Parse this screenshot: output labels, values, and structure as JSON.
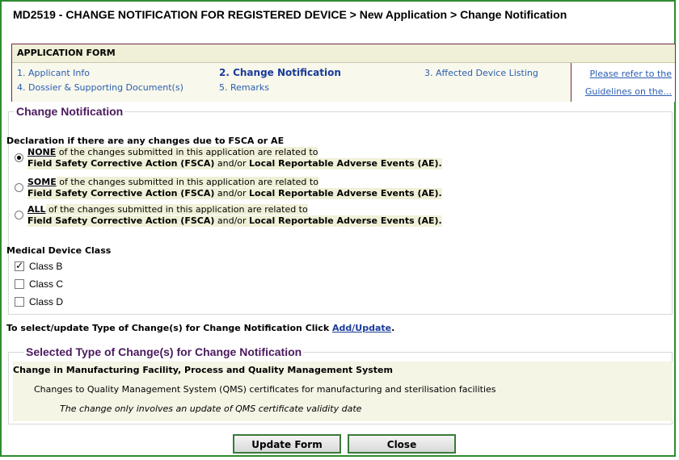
{
  "page": {
    "title": "MD2519 - CHANGE NOTIFICATION FOR REGISTERED DEVICE > New Application > Change Notification"
  },
  "application_form": {
    "header": "APPLICATION FORM",
    "steps": [
      {
        "label": "1. Applicant Info",
        "active": false
      },
      {
        "label": "2. Change Notification",
        "active": true
      },
      {
        "label": "3. Affected Device Listing",
        "active": false
      },
      {
        "label": "4. Dossier & Supporting Document(s)",
        "active": false
      },
      {
        "label": "5. Remarks",
        "active": false
      }
    ],
    "guide_link_line1": "Please refer to the",
    "guide_link_line2": "Guidelines on the..."
  },
  "change_notification": {
    "legend": "Change Notification",
    "declaration_heading": "Declaration if there are any changes due to FSCA or AE",
    "options": [
      {
        "keyword": "NONE",
        "rest_line1": " of the changes submitted in this application are related to",
        "line2_bold1": "Field Safety Corrective Action (FSCA)",
        "line2_mid": " and/or ",
        "line2_bold2": "Local Reportable Adverse Events (AE).",
        "checked": true
      },
      {
        "keyword": "SOME",
        "rest_line1": " of the changes submitted in this application are related to",
        "line2_bold1": "Field Safety Corrective Action (FSCA)",
        "line2_mid": " and/or ",
        "line2_bold2": "Local Reportable Adverse Events (AE).",
        "checked": false
      },
      {
        "keyword": "ALL",
        "rest_line1": " of the changes submitted in this application are related to",
        "line2_bold1": "Field Safety Corrective Action (FSCA)",
        "line2_mid": " and/or ",
        "line2_bold2": "Local Reportable Adverse Events (AE).",
        "checked": false
      }
    ],
    "device_class_heading": "Medical Device Class",
    "device_classes": [
      {
        "label": "Class B",
        "checked": true
      },
      {
        "label": "Class C",
        "checked": false
      },
      {
        "label": "Class D",
        "checked": false
      }
    ]
  },
  "select_update": {
    "text": "To select/update Type of Change(s) for Change Notification Click ",
    "link": "Add/Update",
    "suffix": "."
  },
  "selected_changes": {
    "legend": "Selected Type of Change(s) for Change Notification",
    "category": "Change in Manufacturing Facility, Process and Quality Management System",
    "item": "Changes to Quality Management System (QMS) certificates for manufacturing and sterilisation facilities",
    "detail": "The change only involves an update of QMS certificate validity date"
  },
  "buttons": {
    "update": "Update Form",
    "close": "Close"
  },
  "colors": {
    "frame_border": "#2e8b2e",
    "legend_text": "#4b1a5e",
    "link": "#2a5db0",
    "highlight": "#f0f0d8"
  }
}
